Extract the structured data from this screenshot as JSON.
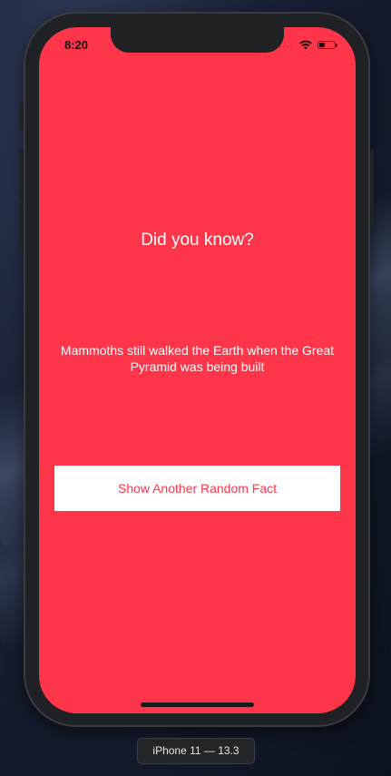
{
  "status_bar": {
    "time": "8:20",
    "signal_dots": "....",
    "battery_level": 0.4
  },
  "main": {
    "title": "Did you know?",
    "fact": "Mammoths still walked the Earth when the Great Pyramid was being built",
    "button_label": "Show Another Random Fact"
  },
  "simulator": {
    "device_label": "iPhone 11 — 13.3"
  },
  "colors": {
    "background": "#ff364a",
    "button_bg": "#ffffff",
    "button_text": "#ff364a",
    "text": "#ffffff"
  }
}
